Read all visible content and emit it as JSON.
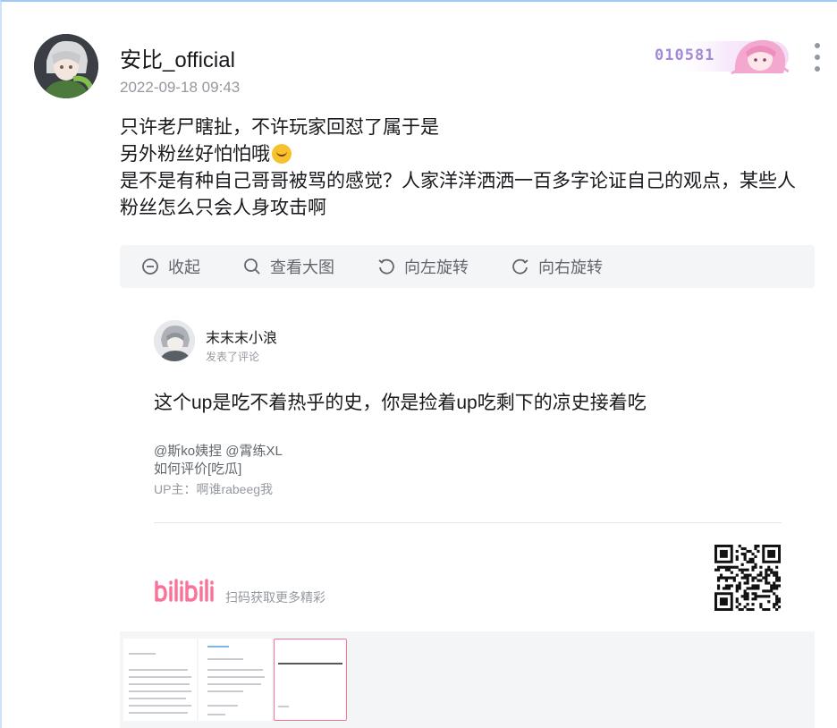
{
  "post": {
    "username": "安比_official",
    "time": "2022-09-18 09:43",
    "fan_number": "010581",
    "lines": [
      "只许老尸瞎扯，不许玩家回怼了属于是",
      "另外粉丝好怕怕哦",
      "是不是有种自己哥哥被骂的感觉？人家洋洋洒洒一百多字论证自己的观点，某些人",
      "粉丝怎么只会人身攻击啊"
    ]
  },
  "toolbar": {
    "collapse": "收起",
    "view_large": "查看大图",
    "rotate_left": "向左旋转",
    "rotate_right": "向右旋转"
  },
  "card": {
    "name": "末末末小浪",
    "subtitle": "发表了评论",
    "text": "这个up是吃不着热乎的史，你是捡着up吃剩下的凉史接着吃",
    "mention": "@斯ko姨捏 @霄练XL",
    "evaluate": "如何评价[吃瓜]",
    "up_line": "UP主：啊谁rabeeg我",
    "logo": "bilibili",
    "scan_tip": "扫码获取更多精彩"
  },
  "colors": {
    "accent_pink": "#fb7299",
    "muted": "#9499a0",
    "fan_badge": "#a38ad8"
  }
}
